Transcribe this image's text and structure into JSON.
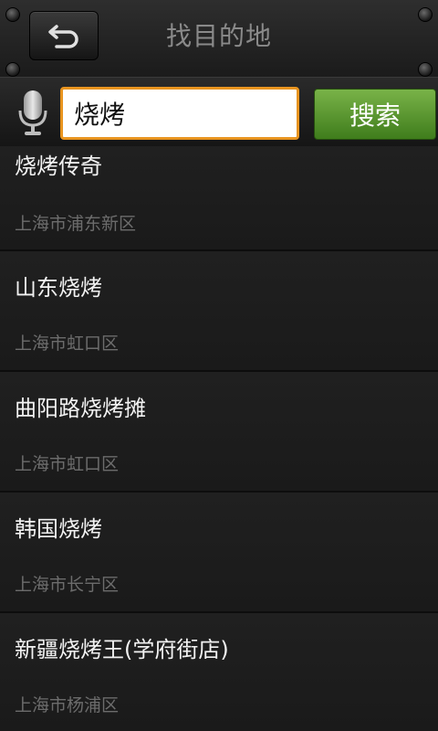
{
  "header": {
    "title": "找目的地"
  },
  "search": {
    "value": "烧烤",
    "button_label": "搜索"
  },
  "results": [
    {
      "name": "烧烤传奇",
      "district": "上海市浦东新区"
    },
    {
      "name": "山东烧烤",
      "district": "上海市虹口区"
    },
    {
      "name": "曲阳路烧烤摊",
      "district": "上海市虹口区"
    },
    {
      "name": "韩国烧烤",
      "district": "上海市长宁区"
    },
    {
      "name": "新疆烧烤王(学府街店)",
      "district": "上海市杨浦区"
    }
  ]
}
